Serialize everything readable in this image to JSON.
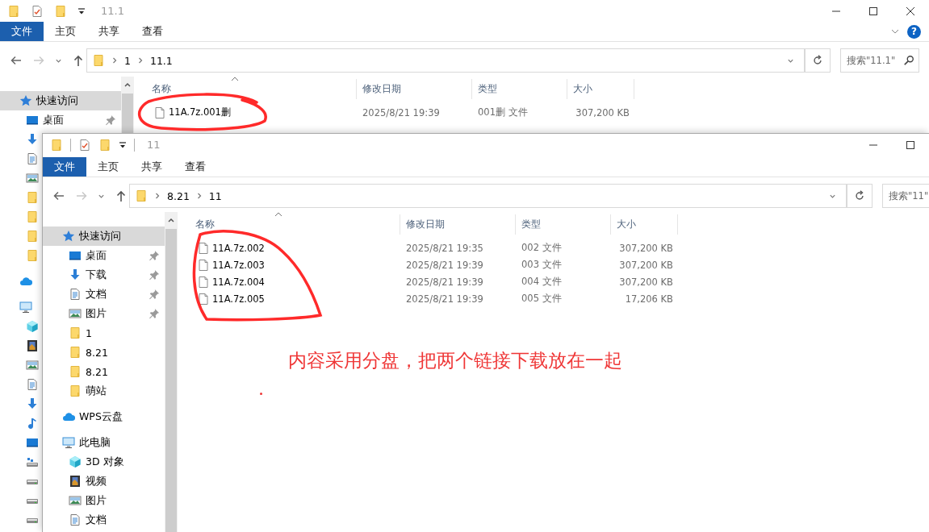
{
  "windows": [
    {
      "title": "11.1",
      "ribbon_tabs": [
        {
          "label": "文件",
          "selected": true
        },
        {
          "label": "主页",
          "selected": false
        },
        {
          "label": "共享",
          "selected": false
        },
        {
          "label": "查看",
          "selected": false
        }
      ],
      "help": "?",
      "path": [
        "1",
        "11.1"
      ],
      "search": {
        "placeholder": "搜索\"11.1\""
      },
      "nav": [
        {
          "label": "快速访问",
          "kind": "star",
          "selected": true,
          "children": [
            {
              "label": "桌面",
              "kind": "desktop",
              "pinned": true,
              "selected": false
            },
            {
              "kind": "download",
              "selected": false
            },
            {
              "kind": "doc",
              "selected": false
            },
            {
              "kind": "pic",
              "selected": false
            },
            {
              "kind": "folder",
              "selected": false
            },
            {
              "kind": "folder",
              "selected": false
            },
            {
              "kind": "folder",
              "selected": false
            },
            {
              "kind": "folder",
              "selected": false
            }
          ]
        },
        {
          "kind": "cloud",
          "selected": false
        },
        {
          "kind": "pc",
          "selected": false,
          "children": [
            {
              "kind": "cube",
              "selected": false
            },
            {
              "kind": "video",
              "selected": false
            },
            {
              "kind": "pic",
              "selected": false
            },
            {
              "kind": "doc",
              "selected": false
            },
            {
              "kind": "download",
              "selected": false
            },
            {
              "kind": "music",
              "selected": false
            },
            {
              "kind": "desktop",
              "selected": false
            },
            {
              "kind": "netdrive",
              "selected": false
            },
            {
              "kind": "drive",
              "selected": false
            },
            {
              "kind": "drive",
              "selected": false
            },
            {
              "kind": "drive",
              "selected": false
            }
          ]
        }
      ],
      "columns": [
        "名称",
        "修改日期",
        "类型",
        "大小"
      ],
      "files": [
        {
          "name": "11A.7z.001删",
          "modified": "2025/8/21 19:39",
          "type": "001删 文件",
          "size": "307,200 KB"
        }
      ]
    },
    {
      "title": "11",
      "ribbon_tabs": [
        {
          "label": "文件",
          "selected": true
        },
        {
          "label": "主页",
          "selected": false
        },
        {
          "label": "共享",
          "selected": false
        },
        {
          "label": "查看",
          "selected": false
        }
      ],
      "path": [
        "8.21",
        "11"
      ],
      "search": {
        "placeholder": "搜索\"11\""
      },
      "nav": [
        {
          "label": "快速访问",
          "kind": "star",
          "selected": true,
          "children": [
            {
              "label": "桌面",
              "kind": "desktop",
              "pinned": true,
              "selected": false
            },
            {
              "label": "下载",
              "kind": "download",
              "pinned": true,
              "selected": false
            },
            {
              "label": "文档",
              "kind": "doc",
              "pinned": true,
              "selected": false
            },
            {
              "label": "图片",
              "kind": "pic",
              "pinned": true,
              "selected": false
            },
            {
              "label": "1",
              "kind": "folder",
              "pinned": false,
              "selected": false
            },
            {
              "label": "8.21",
              "kind": "folder",
              "pinned": false,
              "selected": false
            },
            {
              "label": "8.21",
              "kind": "folder",
              "pinned": false,
              "selected": false
            },
            {
              "label": "萌站",
              "kind": "folder",
              "pinned": false,
              "selected": false
            }
          ]
        },
        {
          "label": "WPS云盘",
          "kind": "cloud",
          "selected": false
        },
        {
          "label": "此电脑",
          "kind": "pc",
          "selected": false,
          "children": [
            {
              "label": "3D 对象",
              "kind": "cube",
              "selected": false
            },
            {
              "label": "视频",
              "kind": "video",
              "selected": false
            },
            {
              "label": "图片",
              "kind": "pic",
              "selected": false
            },
            {
              "label": "文档",
              "kind": "doc",
              "selected": false
            }
          ]
        }
      ],
      "columns": [
        "名称",
        "修改日期",
        "类型",
        "大小"
      ],
      "files": [
        {
          "name": "11A.7z.002",
          "modified": "2025/8/21 19:35",
          "type": "002 文件",
          "size": "307,200 KB"
        },
        {
          "name": "11A.7z.003",
          "modified": "2025/8/21 19:39",
          "type": "003 文件",
          "size": "307,200 KB"
        },
        {
          "name": "11A.7z.004",
          "modified": "2025/8/21 19:39",
          "type": "004 文件",
          "size": "307,200 KB"
        },
        {
          "name": "11A.7z.005",
          "modified": "2025/8/21 19:39",
          "type": "005 文件",
          "size": "17,206 KB"
        }
      ]
    }
  ],
  "annotations": [
    {
      "kind": "circle"
    },
    {
      "kind": "circle"
    },
    {
      "kind": "text",
      "text": "内容采用分盘，把两个链接下载放在一起"
    },
    {
      "kind": "dot"
    }
  ]
}
